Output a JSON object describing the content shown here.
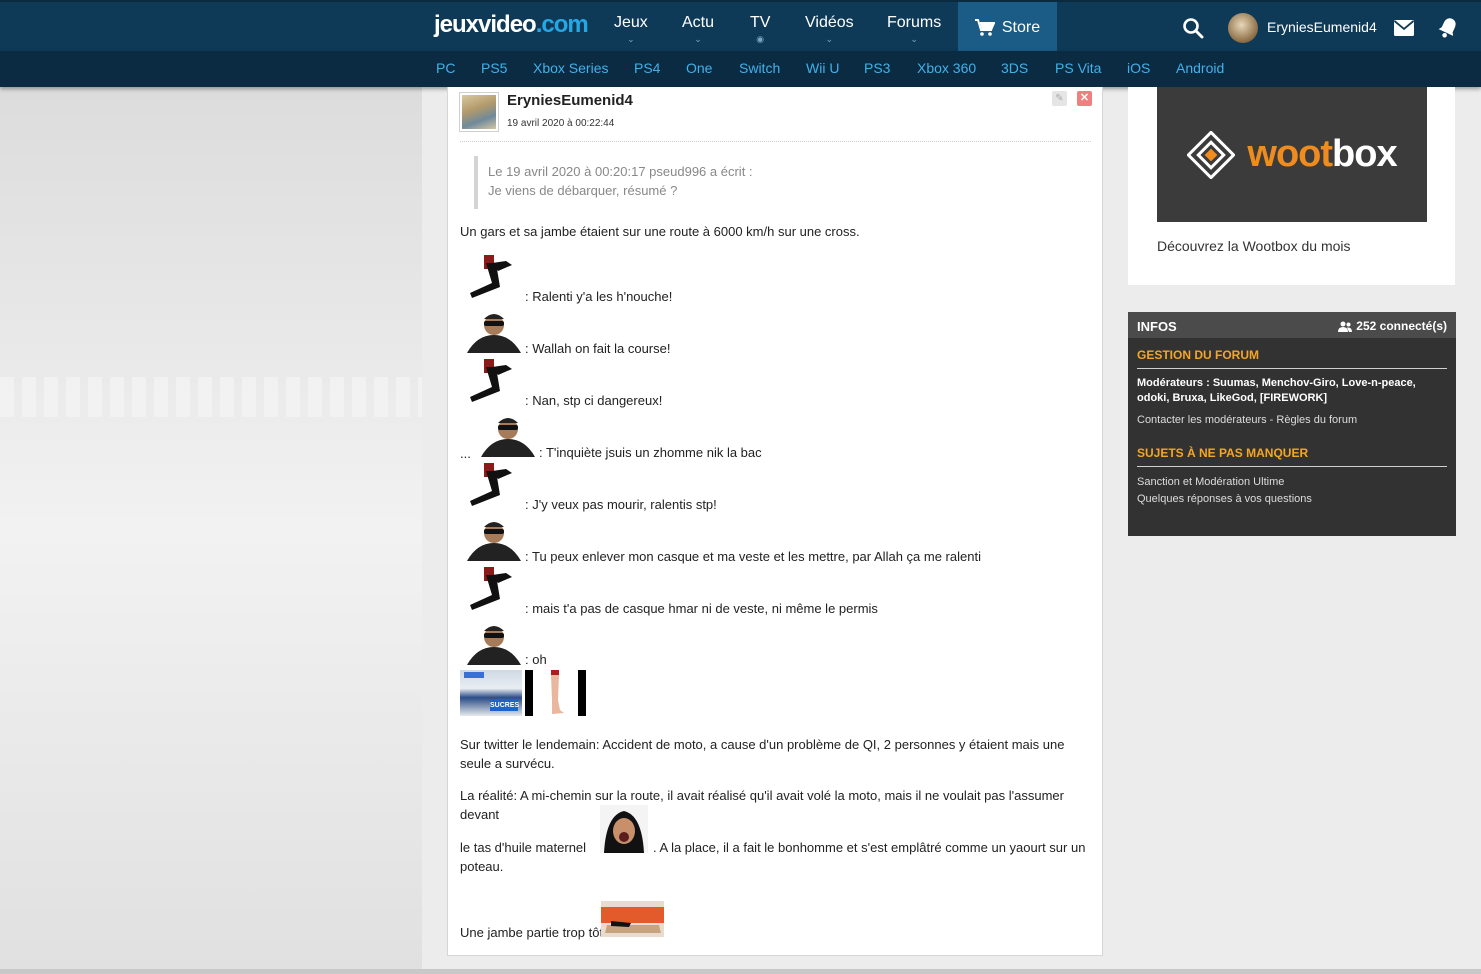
{
  "nav": {
    "logo_main": "jeuxvideo",
    "logo_dot": ".com",
    "items": [
      "Jeux",
      "Actu",
      "TV",
      "Vidéos",
      "Forums"
    ],
    "store_label": "Store",
    "username": "EryniesEumenid4"
  },
  "subnav": [
    "PC",
    "PS5",
    "Xbox Series",
    "PS4",
    "One",
    "Switch",
    "Wii U",
    "PS3",
    "Xbox 360",
    "3DS",
    "PS Vita",
    "iOS",
    "Android"
  ],
  "post": {
    "author": "EryniesEumenid4",
    "date": "19 avril 2020 à 00:22:44",
    "quote_header": "Le 19 avril 2020 à 00:20:17 pseud996 a écrit :",
    "quote_text": "Je viens de débarquer, résumé ?",
    "intro": "Un gars et sa jambe étaient sur une route à 6000 km/h sur une cross.",
    "lines": [
      ": Ralenti y'a les h'nouche!",
      ": Wallah on fait la course!",
      ": Nan, stp ci dangereux!",
      ": T'inquiète jsuis un zhomme nik la bac",
      ": J'y veux pas mourir, ralentis stp!",
      ": Tu peux enlever mon casque et ma veste et les mettre, par Allah ça me ralenti",
      ": mais t'a pas de casque hmar ni de veste, ni même le permis",
      ": oh"
    ],
    "ellipsis": "...",
    "sucres": "SUCRES",
    "twitter": "Sur twitter le lendemain: Accident de moto, a cause d'un problème de QI, 2 personnes y étaient mais une seule a survécu.",
    "reality_1": "La réalité: A mi-chemin sur la route, il avait réalisé qu'il avait volé la moto, mais il ne voulait pas l'assumer devant",
    "reality_2a": "le tas d'huile maternel",
    "reality_2b": ". A la place, il a fait le bonhomme et s'est emplâtré comme un yaourt sur un",
    "reality_3": "poteau.",
    "ending": "Une jambe partie trop tôt"
  },
  "ad": {
    "brand_a": "woot",
    "brand_b": "box",
    "caption": "Découvrez la Wootbox du mois"
  },
  "infos": {
    "title": "INFOS",
    "connected": "252 connecté(s)",
    "gestion_title": "GESTION DU FORUM",
    "moderators_label": "Modérateurs :",
    "moderators": "Suumas, Menchov-Giro, Love-n-peace, odoki, Bruxa, LikeGod, [FIREWORK]",
    "contact": "Contacter les modérateurs",
    "dash": " - ",
    "rules": "Règles du forum",
    "sujets_title": "SUJETS À NE PAS MANQUER",
    "sujet_1": "Sanction et Modération Ultime",
    "sujet_2": "Quelques réponses à vos questions"
  }
}
